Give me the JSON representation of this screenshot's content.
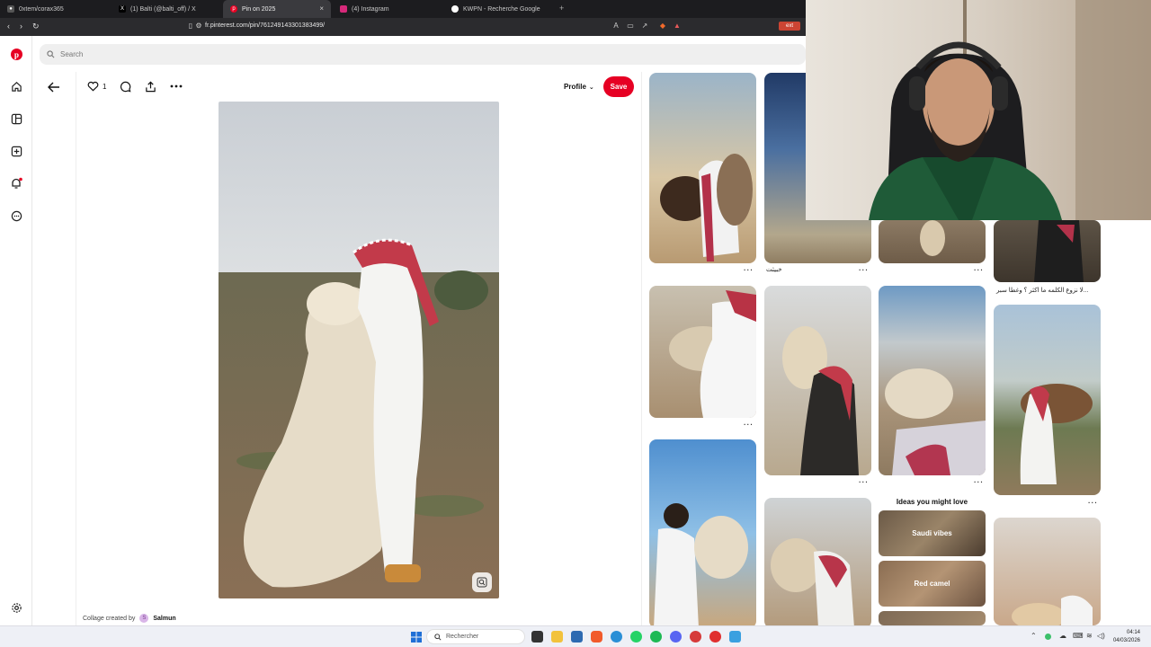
{
  "browser": {
    "tabs": [
      {
        "label": "0xtem/corax365",
        "icon": "github-icon",
        "active": false
      },
      {
        "label": "(1) Balti (@balti_off) / X",
        "icon": "x-icon",
        "active": false
      },
      {
        "label": "Pin on 2025",
        "icon": "pinterest-icon",
        "active": true
      },
      {
        "label": "(4) Instagram",
        "icon": "instagram-icon",
        "active": false
      },
      {
        "label": "KWPN - Recherche Google",
        "icon": "google-icon",
        "active": false
      }
    ],
    "url": "fr.pinterest.com/pin/761249143301383499/"
  },
  "search": {
    "placeholder": "Search"
  },
  "pin": {
    "like_count": "1",
    "profile_label": "Profile",
    "save_label": "Save",
    "collage_label": "Collage created by",
    "creator_initial": "S",
    "creator_name": "Salmun"
  },
  "grid": {
    "caption_1": "خبيثت",
    "caption_2": "لا نزوع الكلمه ما اكثر ؟ وغطا سبر...",
    "ideas_heading": "Ideas you might love",
    "ideas": [
      "Saudi vibes",
      "Red camel"
    ]
  },
  "taskbar": {
    "search_placeholder": "Rechercher",
    "time": "04:14",
    "date": "04/03/2026"
  },
  "colors": {
    "pinterest_red": "#e60023",
    "accent": "#e60023"
  }
}
